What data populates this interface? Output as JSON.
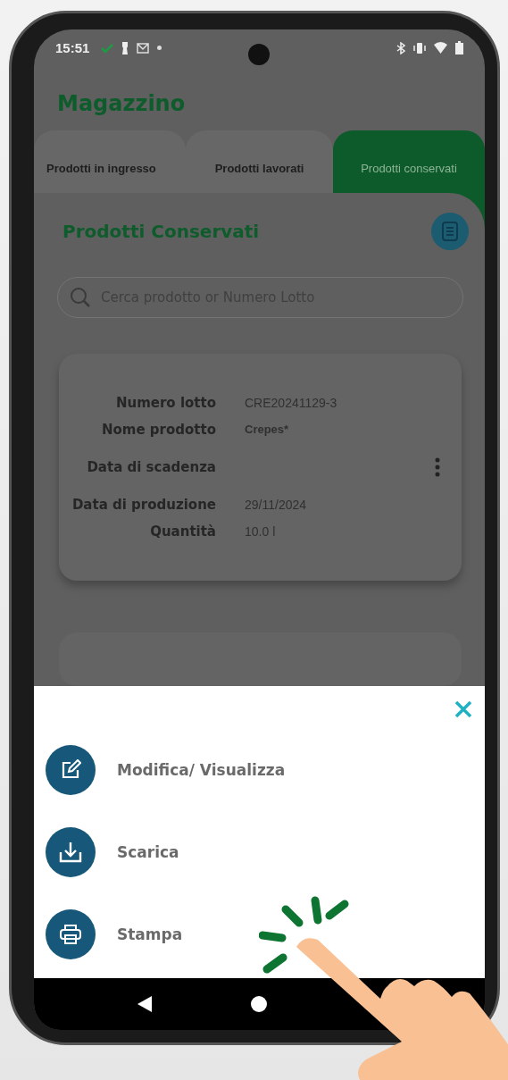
{
  "status_bar": {
    "time": "15:51"
  },
  "app": {
    "title": "Magazzino"
  },
  "tabs": [
    {
      "label": "Prodotti in ingresso",
      "selected": false
    },
    {
      "label": "Prodotti lavorati",
      "selected": false
    },
    {
      "label": "Prodotti conservati",
      "selected": true
    }
  ],
  "section": {
    "title": "Prodotti Conservati"
  },
  "search": {
    "placeholder": "Cerca prodotto or Numero Lotto"
  },
  "cards": [
    {
      "fields": [
        {
          "label": "Numero lotto",
          "value": "CRE20241129-3",
          "kind": "plain"
        },
        {
          "label": "Nome prodotto",
          "value": "Crepes*",
          "kind": "strong"
        },
        {
          "label": "Data di scadenza",
          "kind": "plain"
        },
        {
          "label": "Data di produzione",
          "value": "29/11/2024",
          "kind": "plain"
        },
        {
          "label": "Quantità",
          "value": "10.0 l",
          "kind": "plain"
        }
      ]
    }
  ],
  "sheet": {
    "actions": [
      {
        "kind": "edit",
        "label": "Modifica/ Visualizza"
      },
      {
        "kind": "download",
        "label": "Scarica"
      },
      {
        "kind": "print",
        "label": "Stampa"
      }
    ]
  }
}
